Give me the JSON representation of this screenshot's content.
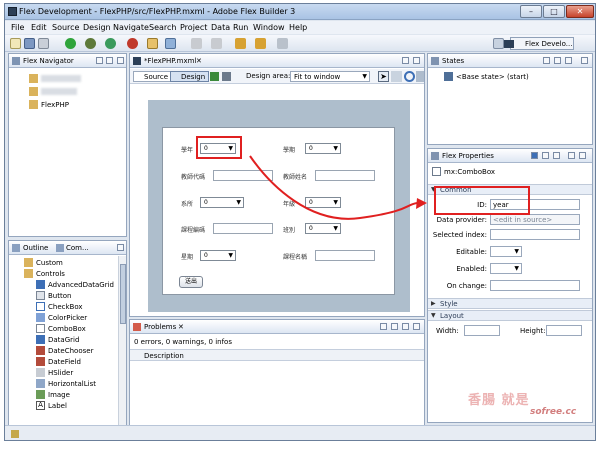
{
  "window": {
    "title": "Flex Development - FlexPHP/src/FlexPHP.mxml - Adobe Flex Builder 3",
    "minimize": "–",
    "maximize": "□",
    "close": "✕"
  },
  "menu": [
    "File",
    "Edit",
    "Source",
    "Design",
    "Navigate",
    "Search",
    "Project",
    "Data",
    "Run",
    "Window",
    "Help"
  ],
  "perspective": "Flex Develo...",
  "navigator": {
    "title": "Flex Navigator",
    "project": "FlexPHP"
  },
  "components": {
    "tab_outline": "Outline",
    "tab_components": "Com...",
    "items": [
      "Custom",
      "Controls",
      "AdvancedDataGrid",
      "Button",
      "CheckBox",
      "ColorPicker",
      "ComboBox",
      "DataGrid",
      "DateChooser",
      "DateField",
      "HSlider",
      "HorizontalList",
      "Image",
      "Label"
    ]
  },
  "editor": {
    "tab": "*FlexPHP.mxml",
    "source_btn": "Source",
    "design_btn": "Design",
    "design_area_label": "Design area:",
    "design_area_value": "Fit to window"
  },
  "form": {
    "labels": [
      "學年",
      "學期",
      "教師代碼",
      "教師姓名",
      "系所",
      "年級",
      "課程編碼",
      "班別",
      "星期",
      "課程名稱"
    ],
    "combo_value": "0",
    "combo_arrow": "▼",
    "submit": "送出"
  },
  "problems": {
    "title": "Problems",
    "status": "0 errors, 0 warnings, 0 infos",
    "column": "Description"
  },
  "states": {
    "title": "States",
    "base": "<Base state> (start)"
  },
  "properties": {
    "title": "Flex Properties",
    "component": "mx:ComboBox",
    "section_common": "Common",
    "id_label": "ID:",
    "id_value": "year",
    "dataprovider_label": "Data provider:",
    "dataprovider_placeholder": "<edit in source>",
    "selectedindex_label": "Selected index:",
    "editable_label": "Editable:",
    "enabled_label": "Enabled:",
    "onchange_label": "On change:",
    "section_style": "Style",
    "section_layout": "Layout",
    "width_label": "Width:",
    "height_label": "Height:"
  },
  "watermark": "sofree.cc",
  "colors": {
    "highlight": "#e02020",
    "accent_blue": "#3d6fb6"
  }
}
